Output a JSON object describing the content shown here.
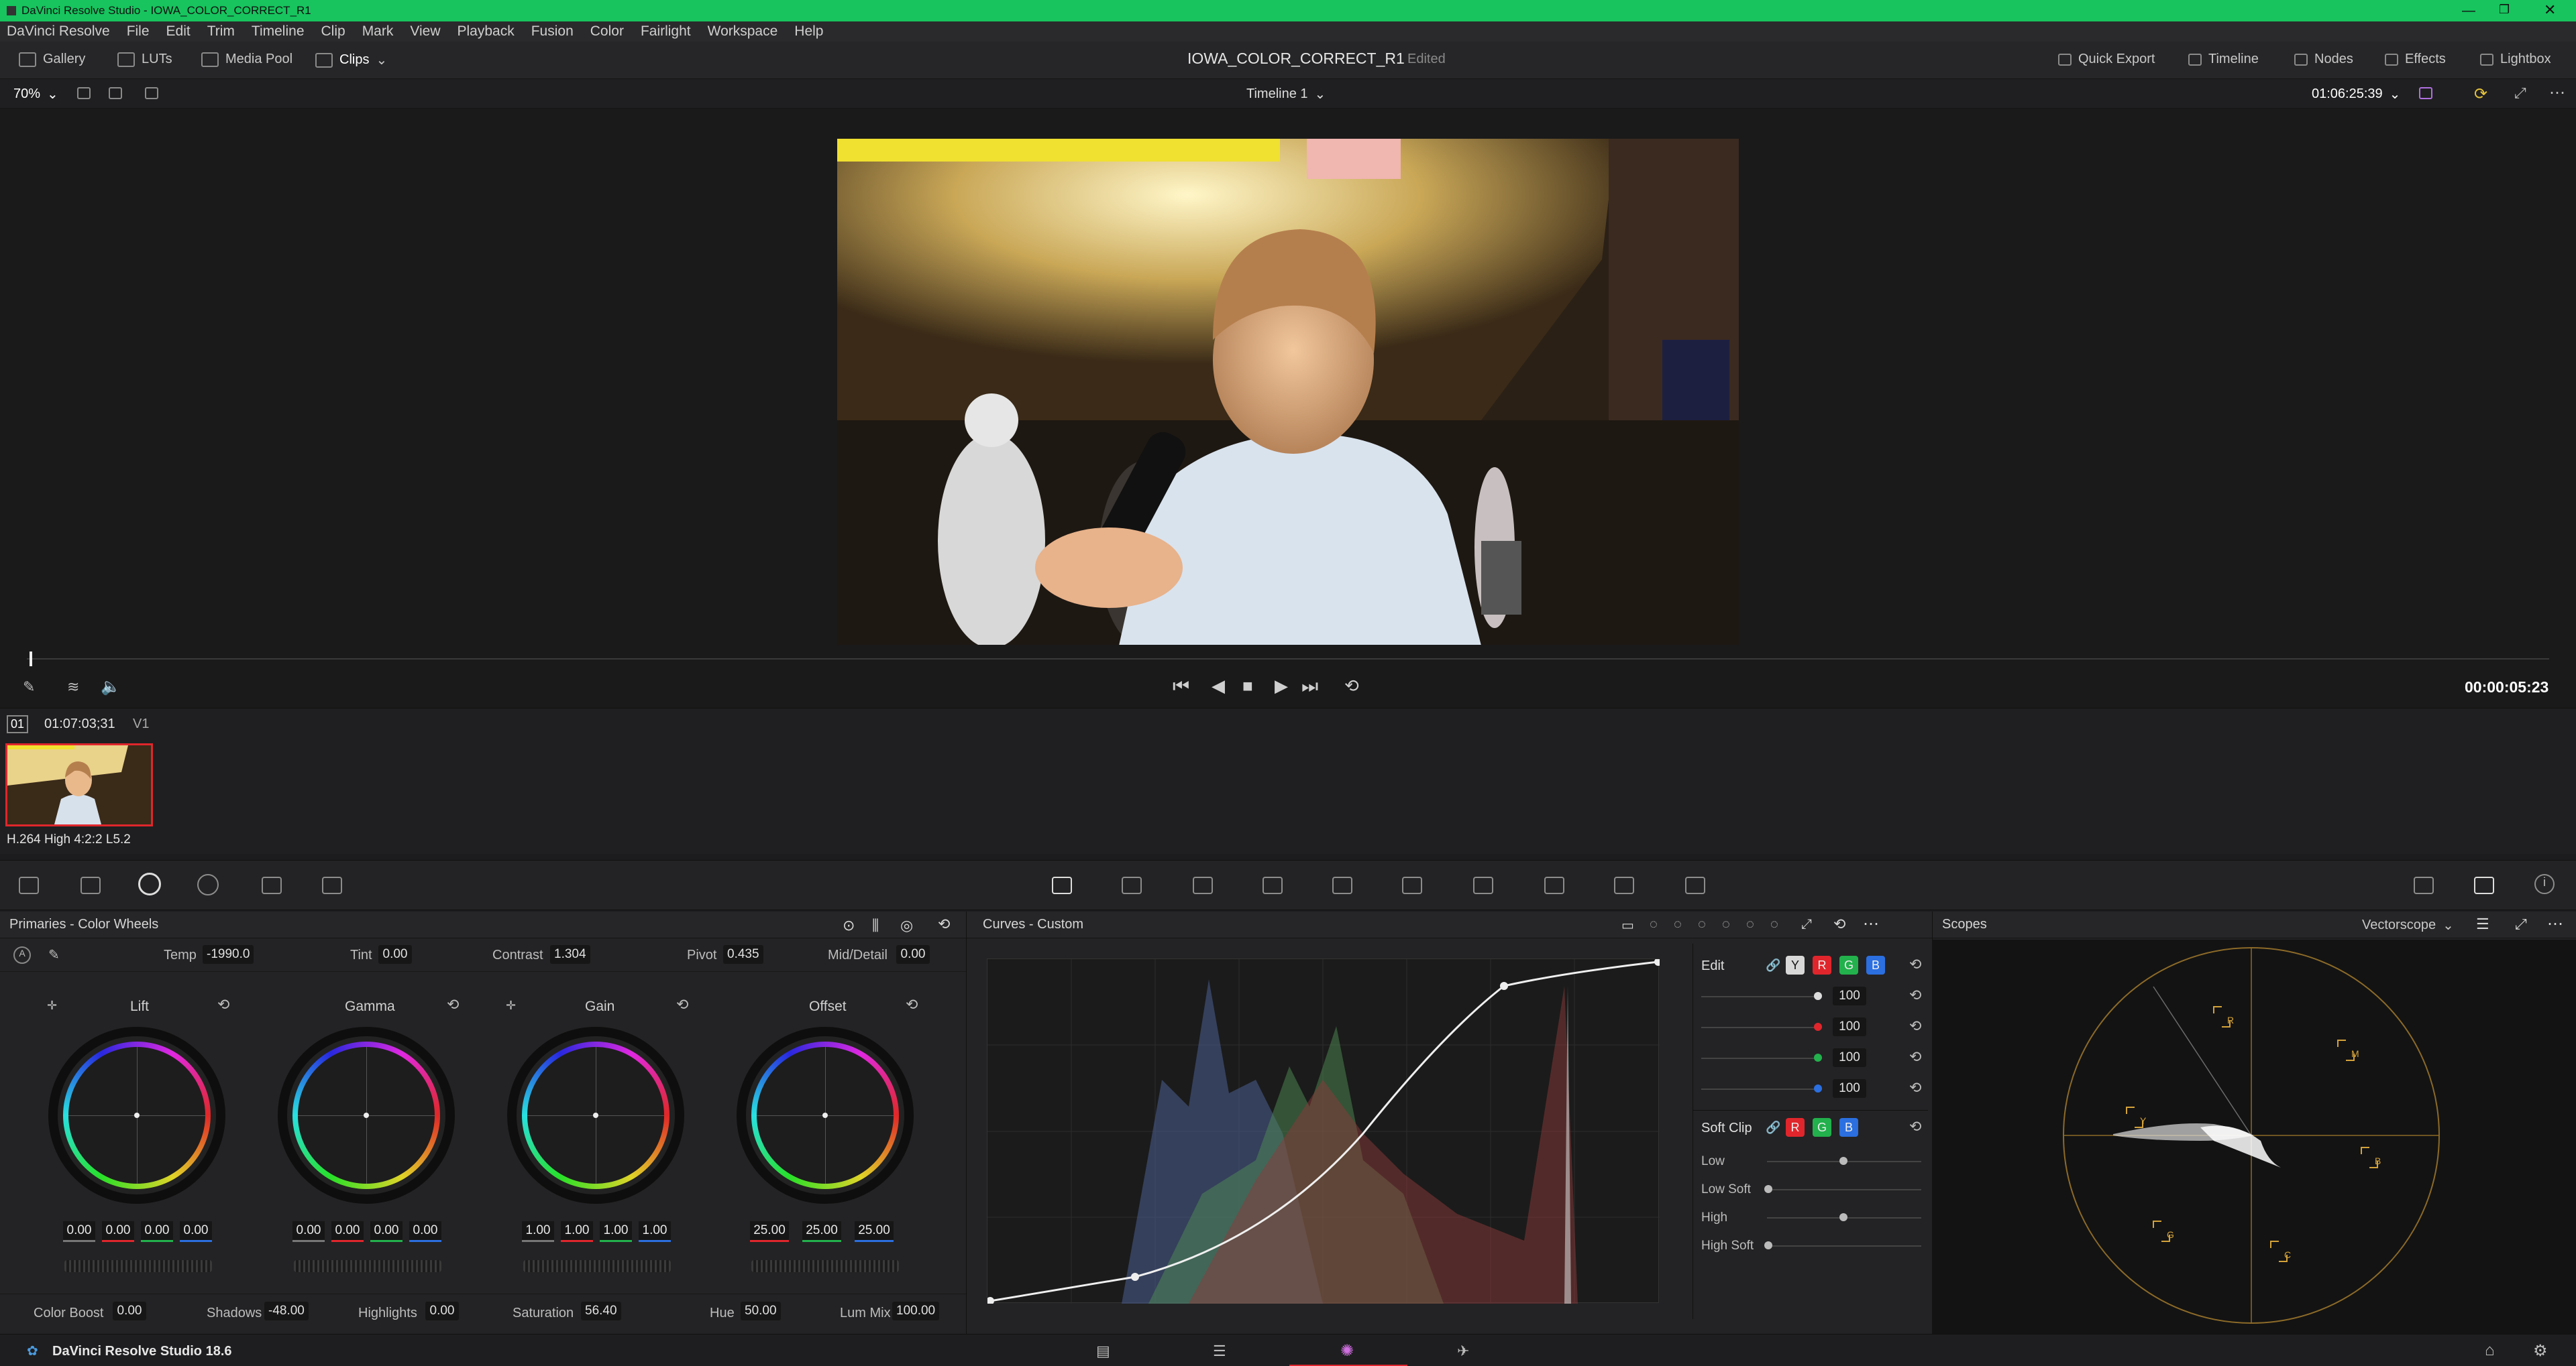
{
  "window": {
    "title": "DaVinci Resolve Studio - IOWA_COLOR_CORRECT_R1"
  },
  "menu": [
    "DaVinci Resolve",
    "File",
    "Edit",
    "Trim",
    "Timeline",
    "Clip",
    "Mark",
    "View",
    "Playback",
    "Fusion",
    "Color",
    "Fairlight",
    "Workspace",
    "Help"
  ],
  "toolbar": {
    "gallery": "Gallery",
    "luts": "LUTs",
    "media_pool": "Media Pool",
    "clips": "Clips",
    "project": "IOWA_COLOR_CORRECT_R1",
    "status": "Edited",
    "quick_export": "Quick Export",
    "timeline": "Timeline",
    "nodes": "Nodes",
    "effects": "Effects",
    "lightbox": "Lightbox"
  },
  "viewer": {
    "zoom": "70%",
    "timeline_name": "Timeline 1",
    "timecode": "01:06:25:39",
    "playhead_time": "00:00:05:23"
  },
  "clip": {
    "number": "01",
    "timecode": "01:07:03;31",
    "track": "V1",
    "codec": "H.264 High 4:2:2 L5.2"
  },
  "primaries": {
    "title": "Primaries - Color Wheels",
    "temp_label": "Temp",
    "temp": "-1990.0",
    "tint_label": "Tint",
    "tint": "0.00",
    "contrast_label": "Contrast",
    "contrast": "1.304",
    "pivot_label": "Pivot",
    "pivot": "0.435",
    "middetail_label": "Mid/Detail",
    "middetail": "0.00",
    "wheels": [
      {
        "name": "Lift",
        "values": [
          "0.00",
          "0.00",
          "0.00",
          "0.00"
        ]
      },
      {
        "name": "Gamma",
        "values": [
          "0.00",
          "0.00",
          "0.00",
          "0.00"
        ]
      },
      {
        "name": "Gain",
        "values": [
          "1.00",
          "1.00",
          "1.00",
          "1.00"
        ]
      },
      {
        "name": "Offset",
        "values": [
          "25.00",
          "25.00",
          "25.00"
        ]
      }
    ],
    "colorboost_label": "Color Boost",
    "colorboost": "0.00",
    "shadows_label": "Shadows",
    "shadows": "-48.00",
    "highlights_label": "Highlights",
    "highlights": "0.00",
    "saturation_label": "Saturation",
    "saturation": "56.40",
    "hue_label": "Hue",
    "hue": "50.00",
    "lummix_label": "Lum Mix",
    "lummix": "100.00"
  },
  "curves": {
    "title": "Curves - Custom",
    "edit_label": "Edit",
    "channels": [
      "Y",
      "R",
      "G",
      "B"
    ],
    "intensity": [
      "100",
      "100",
      "100",
      "100"
    ],
    "softclip_label": "Soft Clip",
    "low": "Low",
    "low_soft": "Low Soft",
    "high": "High",
    "high_soft": "High Soft"
  },
  "scopes": {
    "title": "Scopes",
    "mode": "Vectorscope",
    "targets": [
      "R",
      "M",
      "B",
      "C",
      "G",
      "Y"
    ]
  },
  "footer": {
    "app": "DaVinci Resolve Studio 18.6"
  },
  "colors": {
    "titlebar": "#17c45e",
    "accent_red": "#e0262c",
    "accent_green": "#22b14c",
    "accent_blue": "#2b6fe0"
  }
}
